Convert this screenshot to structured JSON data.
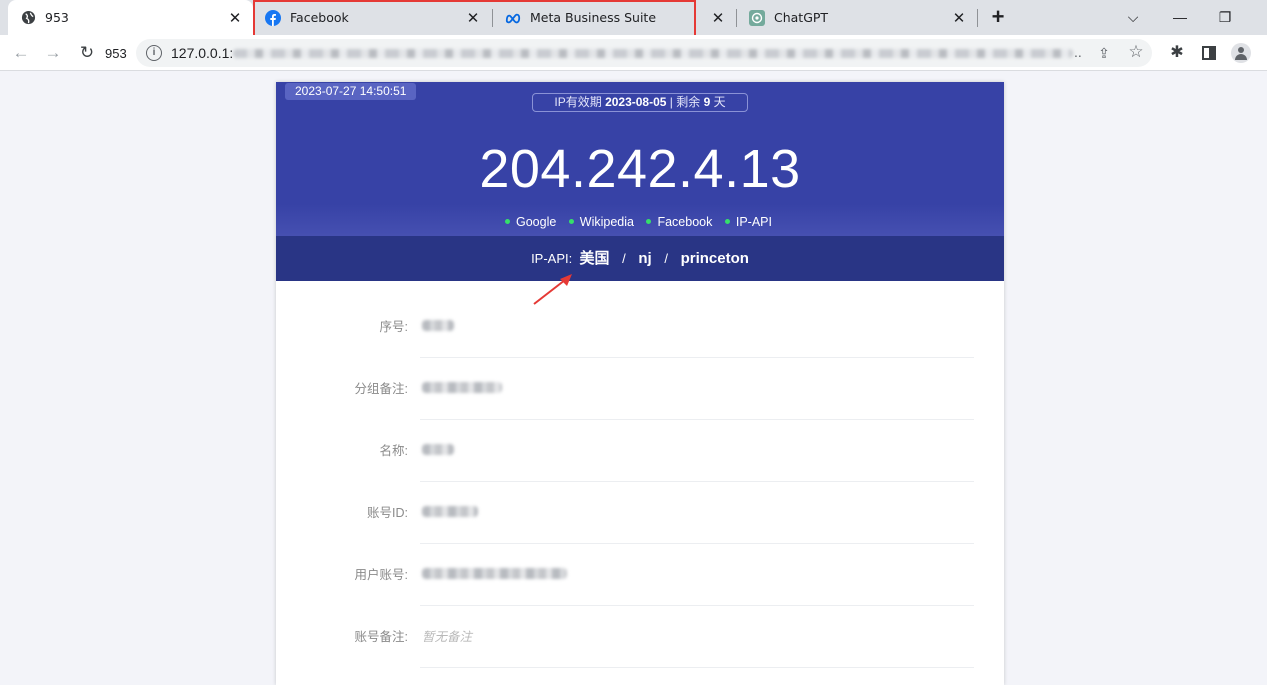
{
  "browser": {
    "tabs": [
      {
        "title": "953",
        "icon": "globe-icon",
        "active": true
      },
      {
        "title": "Facebook",
        "icon": "facebook-icon",
        "active": false
      },
      {
        "title": "Meta Business Suite",
        "icon": "meta-icon",
        "active": false
      },
      {
        "title": "ChatGPT",
        "icon": "chatgpt-icon",
        "active": false
      }
    ],
    "new_tab_label": "+",
    "reload_label": "953",
    "address_visible": "127.0.0.1:",
    "address_ellipsis": ".."
  },
  "page": {
    "datetime": "2023-07-27 14:50:51",
    "validity": {
      "prefix": "IP有效期",
      "date": "2023-08-05",
      "sep": " | 剩余 ",
      "days": "9",
      "suffix": " 天"
    },
    "ip": "204.242.4.13",
    "sites": [
      "Google",
      "Wikipedia",
      "Facebook",
      "IP-API"
    ],
    "status_color": "#35e06a",
    "ip_api": {
      "label": "IP-API:",
      "country": "美国",
      "region": "nj",
      "city": "princeton",
      "separator": "/"
    },
    "fields": [
      {
        "label": "序号:",
        "value": null
      },
      {
        "label": "分组备注:",
        "value": null
      },
      {
        "label": "名称:",
        "value": null
      },
      {
        "label": "账号ID:",
        "value": null
      },
      {
        "label": "用户账号:",
        "value": null
      },
      {
        "label": "账号备注:",
        "value": "暂无备注"
      }
    ]
  },
  "colors": {
    "hero": "#3742a6",
    "ipapi_bar": "#293585",
    "annotation": "#e53935"
  }
}
